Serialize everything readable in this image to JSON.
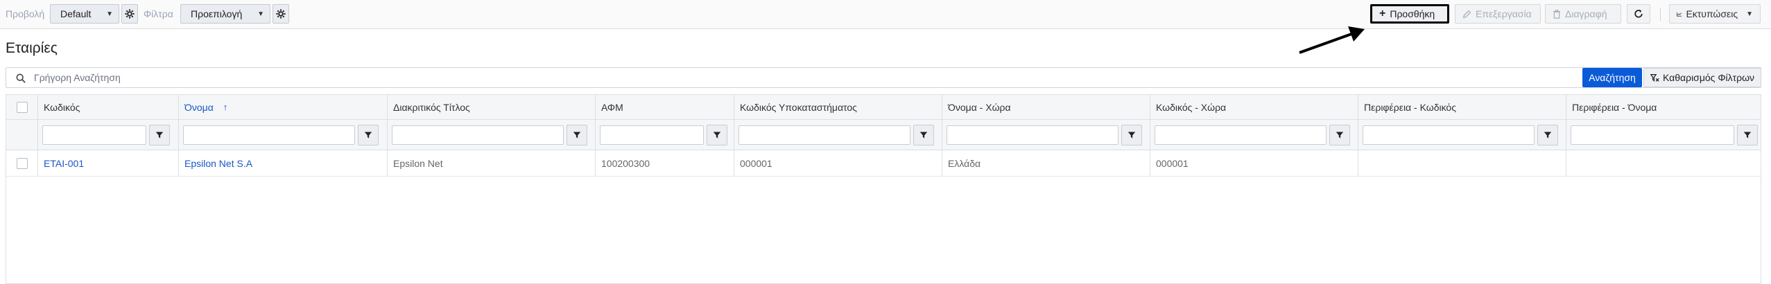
{
  "toolbar": {
    "view_label": "Προβολή",
    "view_value": "Default",
    "filters_label": "Φίλτρα",
    "filters_value": "Προεπιλογή",
    "add_label": "Προσθήκη",
    "edit_label": "Επεξεργασία",
    "delete_label": "Διαγραφή",
    "prints_label": "Εκτυπώσεις"
  },
  "page": {
    "title": "Εταιρίες"
  },
  "search": {
    "placeholder": "Γρήγορη Αναζήτηση",
    "search_button": "Αναζήτηση",
    "clear_filters_button": "Καθαρισμός Φίλτρων"
  },
  "table": {
    "columns": [
      {
        "label": "Κωδικός"
      },
      {
        "label": "Όνομα"
      },
      {
        "label": "Διακριτικός Τίτλος"
      },
      {
        "label": "ΑΦΜ"
      },
      {
        "label": "Κωδικός Υποκαταστήματος"
      },
      {
        "label": "Όνομα - Χώρα"
      },
      {
        "label": "Κωδικός - Χώρα"
      },
      {
        "label": "Περιφέρεια - Κωδικός"
      },
      {
        "label": "Περιφέρεια - Όνομα"
      }
    ],
    "sorted_column": "Όνομα",
    "sort_direction": "ascending",
    "rows": [
      [
        "ETAI-001",
        "Epsilon Net S.A",
        "Epsilon Net",
        "100200300",
        "000001",
        "Ελλάδα",
        "000001",
        "",
        ""
      ]
    ]
  },
  "colors": {
    "accent": "#0a5bd8",
    "link": "#1a56c4"
  }
}
